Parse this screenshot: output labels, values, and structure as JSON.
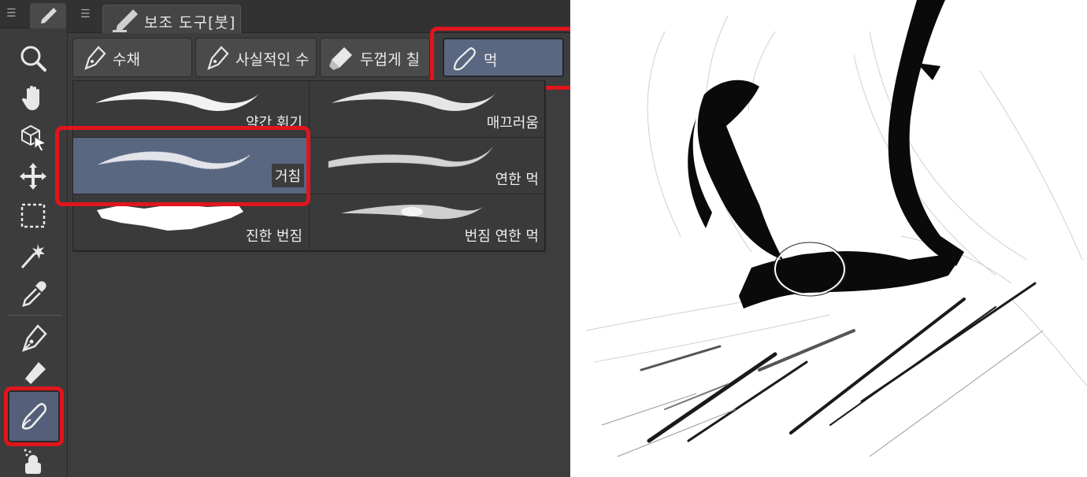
{
  "panel": {
    "title": "보조 도구[붓]",
    "groups": [
      {
        "label": "수채",
        "icon": "brush-nib-icon",
        "active": false
      },
      {
        "label": "사실적인 수",
        "icon": "brush-nib-icon",
        "active": false
      },
      {
        "label": "두껍게 칠",
        "icon": "paint-tube-icon",
        "active": false
      },
      {
        "label": "먹",
        "icon": "ink-brush-icon",
        "active": true
      }
    ],
    "brushes": [
      {
        "label": "약간 휘기",
        "active": false
      },
      {
        "label": "매끄러움",
        "active": false
      },
      {
        "label": "거침",
        "active": true
      },
      {
        "label": "연한 먹",
        "active": false
      },
      {
        "label": "진한 번짐",
        "active": false
      },
      {
        "label": "번짐 연한 먹",
        "active": false
      }
    ]
  },
  "toolbar": {
    "tools": [
      {
        "name": "zoom-tool",
        "icon": "magnifier-icon"
      },
      {
        "name": "hand-tool",
        "icon": "hand-icon"
      },
      {
        "name": "object-tool",
        "icon": "cube-cursor-icon"
      },
      {
        "name": "move-tool",
        "icon": "move-arrows-icon"
      },
      {
        "name": "selection-tool",
        "icon": "dashed-rect-icon"
      },
      {
        "name": "auto-select-tool",
        "icon": "magic-wand-icon"
      },
      {
        "name": "eyedropper-tool",
        "icon": "eyedropper-icon"
      },
      {
        "name": "pen-tool",
        "icon": "pen-nib-icon"
      },
      {
        "name": "pencil-tool",
        "icon": "pencil-icon"
      },
      {
        "name": "brush-tool",
        "icon": "brush-icon",
        "active": true
      },
      {
        "name": "airbrush-tool",
        "icon": "airbrush-icon"
      }
    ]
  },
  "colors": {
    "panel_bg": "#3d3d3d",
    "active_bg": "#5a6781",
    "highlight": "#e0151d"
  }
}
